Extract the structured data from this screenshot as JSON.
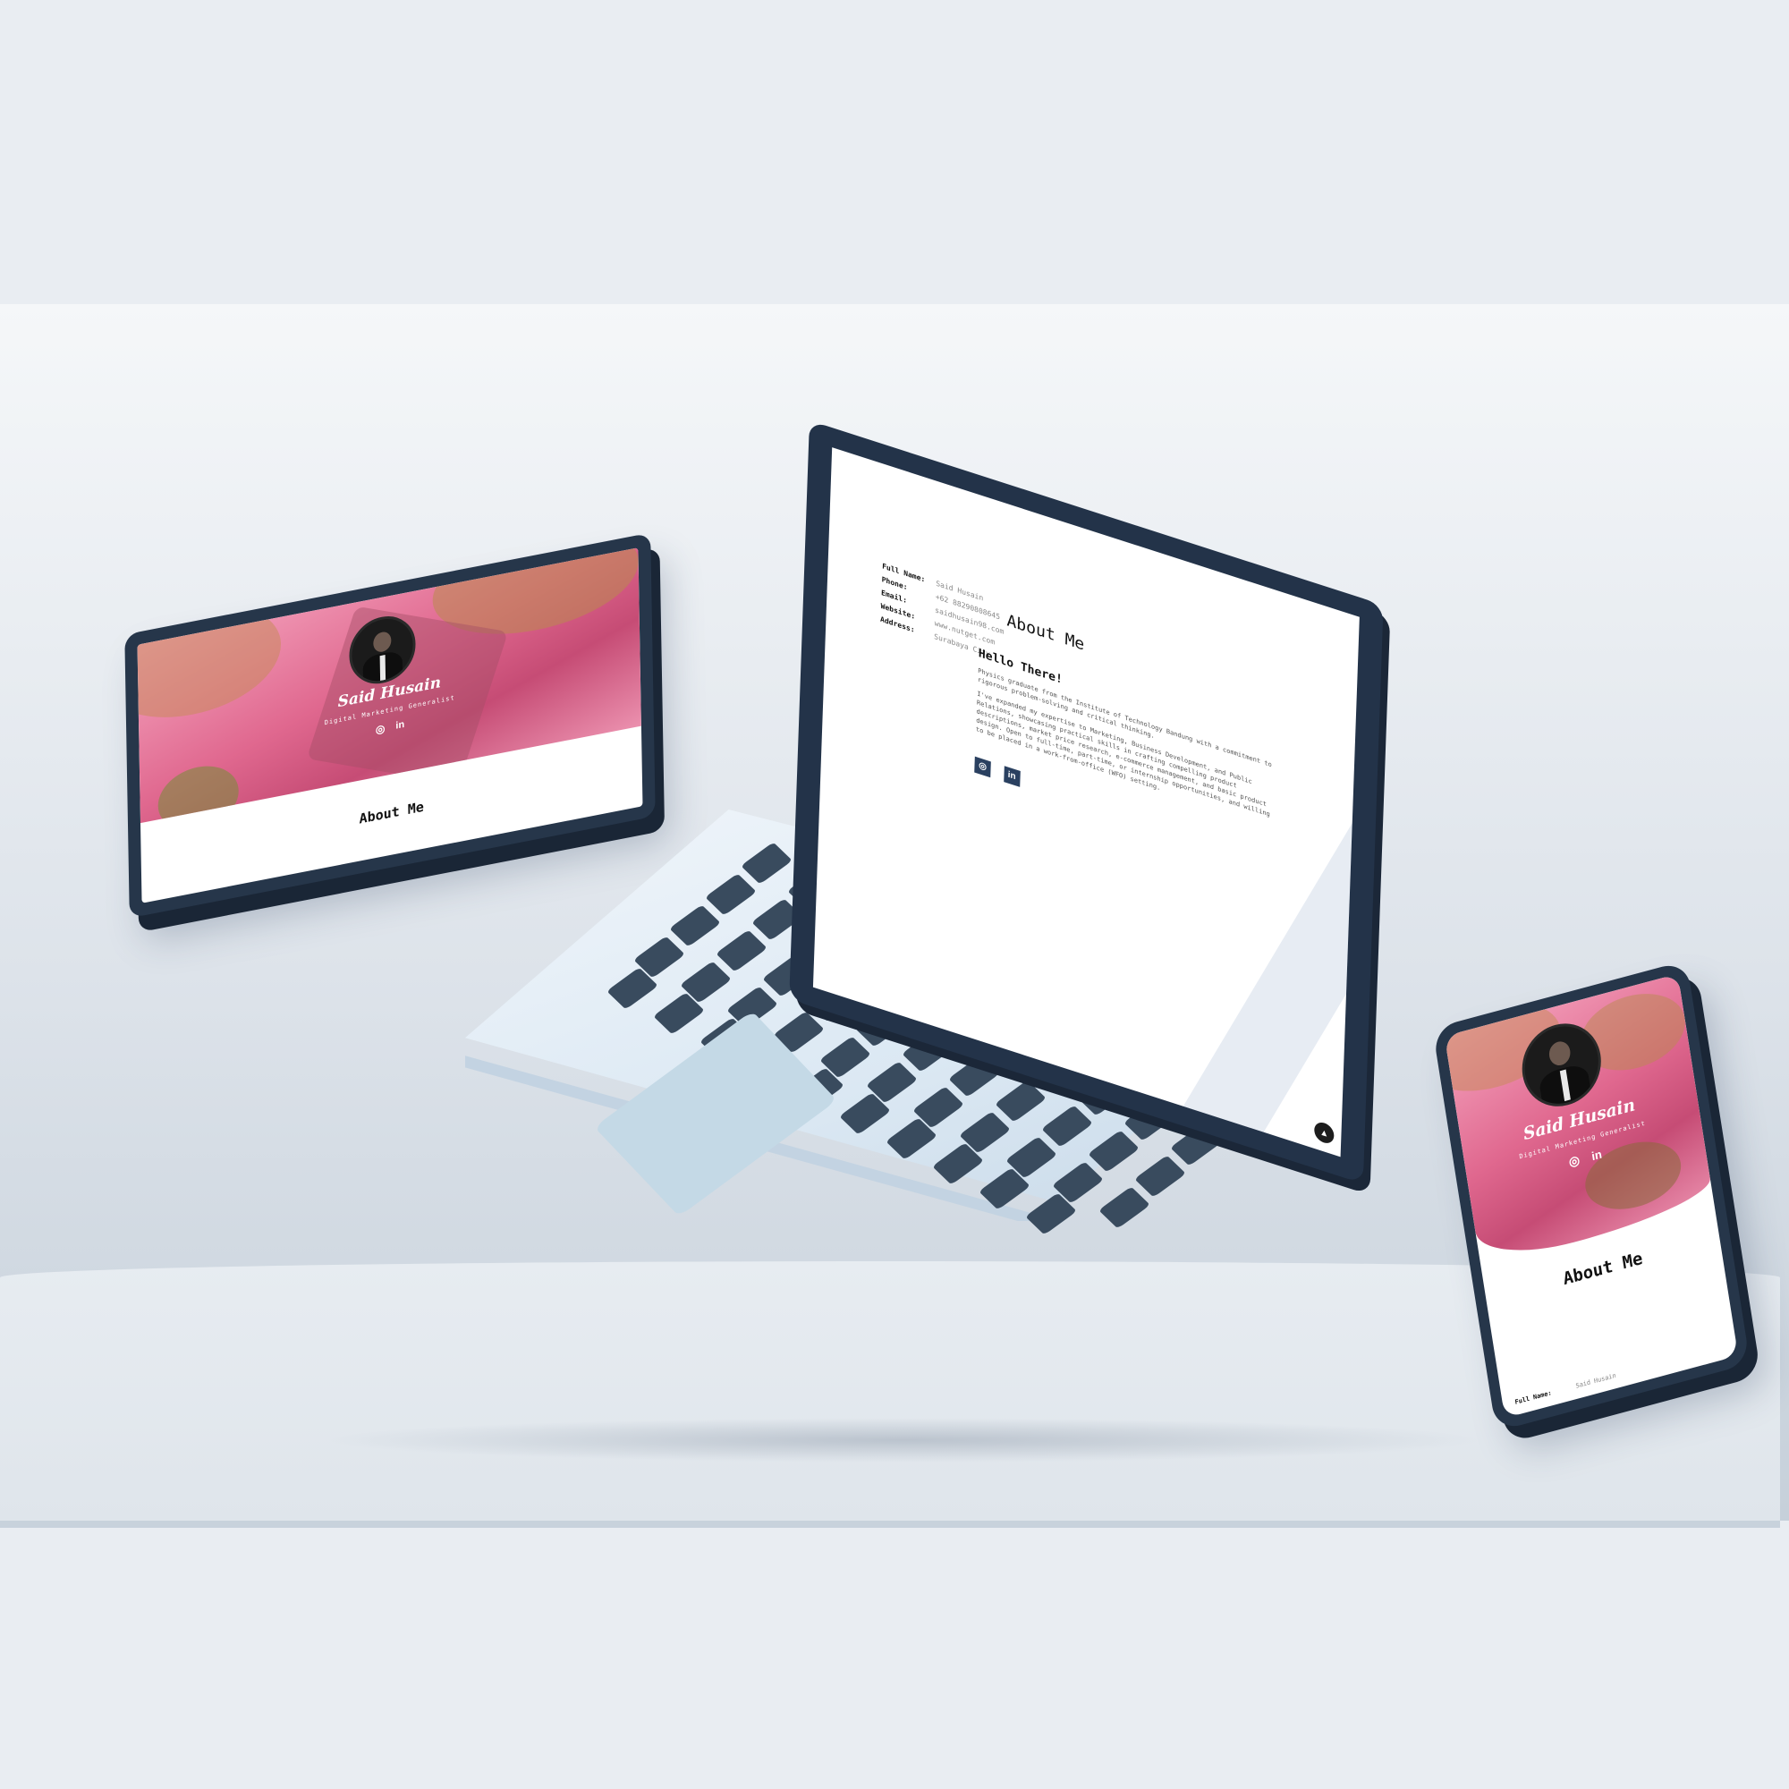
{
  "profile": {
    "name": "Said Husain",
    "role": "Digital Marketing Generalist",
    "about_title": "About Me",
    "greeting": "Hello There!",
    "intro": "Physics graduate from the Institute of Technology Bandung with a commitment to rigorous problem-solving and critical thinking.",
    "body": "I've expanded my expertise to Marketing, Business Development, and Public Relations, showcasing practical skills in crafting compelling product descriptions, market price research, e-commerce management, and basic product design. Open to full-time, part-time, or internship opportunities, and willing to be placed in a work-from-office (WFO) setting."
  },
  "info": [
    {
      "label": "Full Name:",
      "value": "Said Husain"
    },
    {
      "label": "Phone:",
      "value": "+62 88290808645"
    },
    {
      "label": "Email:",
      "value": "saidhusain98.com"
    },
    {
      "label": "Website:",
      "value": "www.nutget.com"
    },
    {
      "label": "Address:",
      "value": "Surabaya City"
    }
  ],
  "phone_info_row": {
    "label": "Full Name:",
    "value": "Said Husain"
  },
  "icons": {
    "instagram": "instagram-icon",
    "linkedin": "linkedin-icon",
    "linkedin_glyph": "in",
    "instagram_glyph": "◎",
    "scroll_top": "arrow-up-icon",
    "scroll_glyph": "▲"
  },
  "colors": {
    "device": "#26364a",
    "hero_pink": "#e0688f",
    "accent_navy": "#2a4060"
  }
}
